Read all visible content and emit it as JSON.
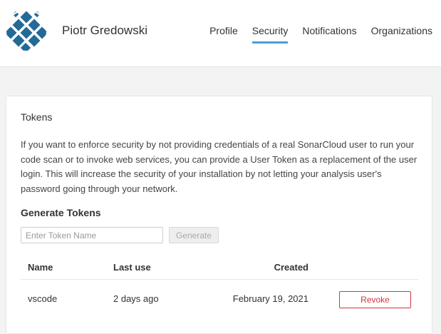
{
  "user": {
    "name": "Piotr Gredowski"
  },
  "nav": {
    "items": [
      {
        "label": "Profile"
      },
      {
        "label": "Security"
      },
      {
        "label": "Notifications"
      },
      {
        "label": "Organizations"
      }
    ],
    "active": "Security"
  },
  "tokens": {
    "title": "Tokens",
    "description": "If you want to enforce security by not providing credentials of a real SonarCloud user to run your code scan or to invoke web services, you can provide a User Token as a replacement of the user login. This will increase the security of your installation by not letting your analysis user's password going through your network.",
    "generate_title": "Generate Tokens",
    "input_placeholder": "Enter Token Name",
    "input_value": "",
    "generate_label": "Generate",
    "columns": {
      "name": "Name",
      "last_use": "Last use",
      "created": "Created"
    },
    "rows": [
      {
        "name": "vscode",
        "last_use": "2 days ago",
        "created": "February 19, 2021",
        "action": "Revoke"
      }
    ]
  },
  "colors": {
    "accent": "#4b9fd5",
    "danger": "#d4333f",
    "avatar": "#236a97"
  }
}
